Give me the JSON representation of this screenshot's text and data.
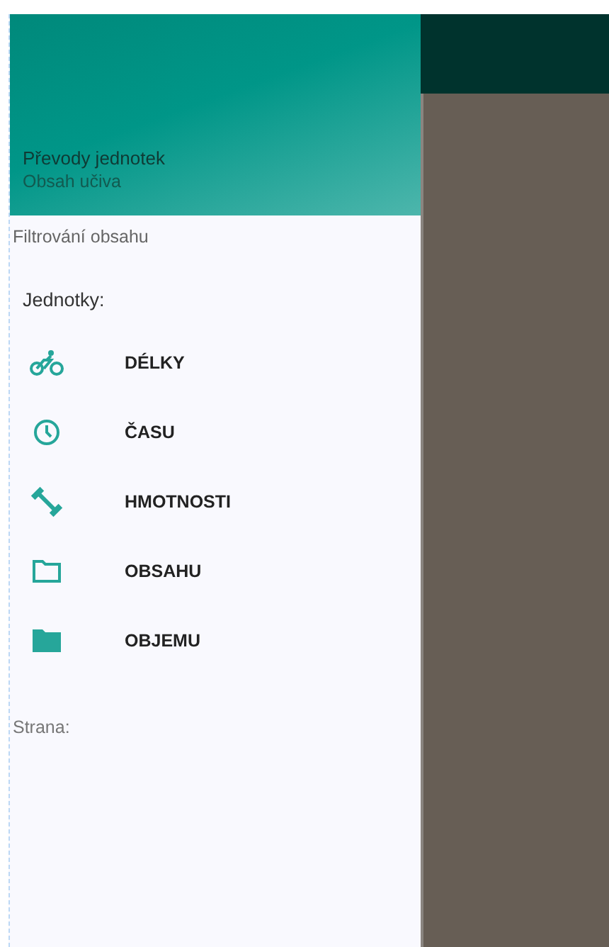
{
  "drawer": {
    "header": {
      "title": "Převody jednotek",
      "subtitle": "Obsah učiva"
    },
    "filter_label": "Filtrování obsahu",
    "units_label": "Jednotky:",
    "items": [
      {
        "kind": "bike",
        "label": "DÉLKY"
      },
      {
        "kind": "clock",
        "label": "ČASU"
      },
      {
        "kind": "dumbbell",
        "label": "HMOTNOSTI"
      },
      {
        "kind": "folder-outline",
        "label": "OBSAHU"
      },
      {
        "kind": "folder",
        "label": "OBJEMU"
      }
    ],
    "page_label": "Strana:"
  }
}
